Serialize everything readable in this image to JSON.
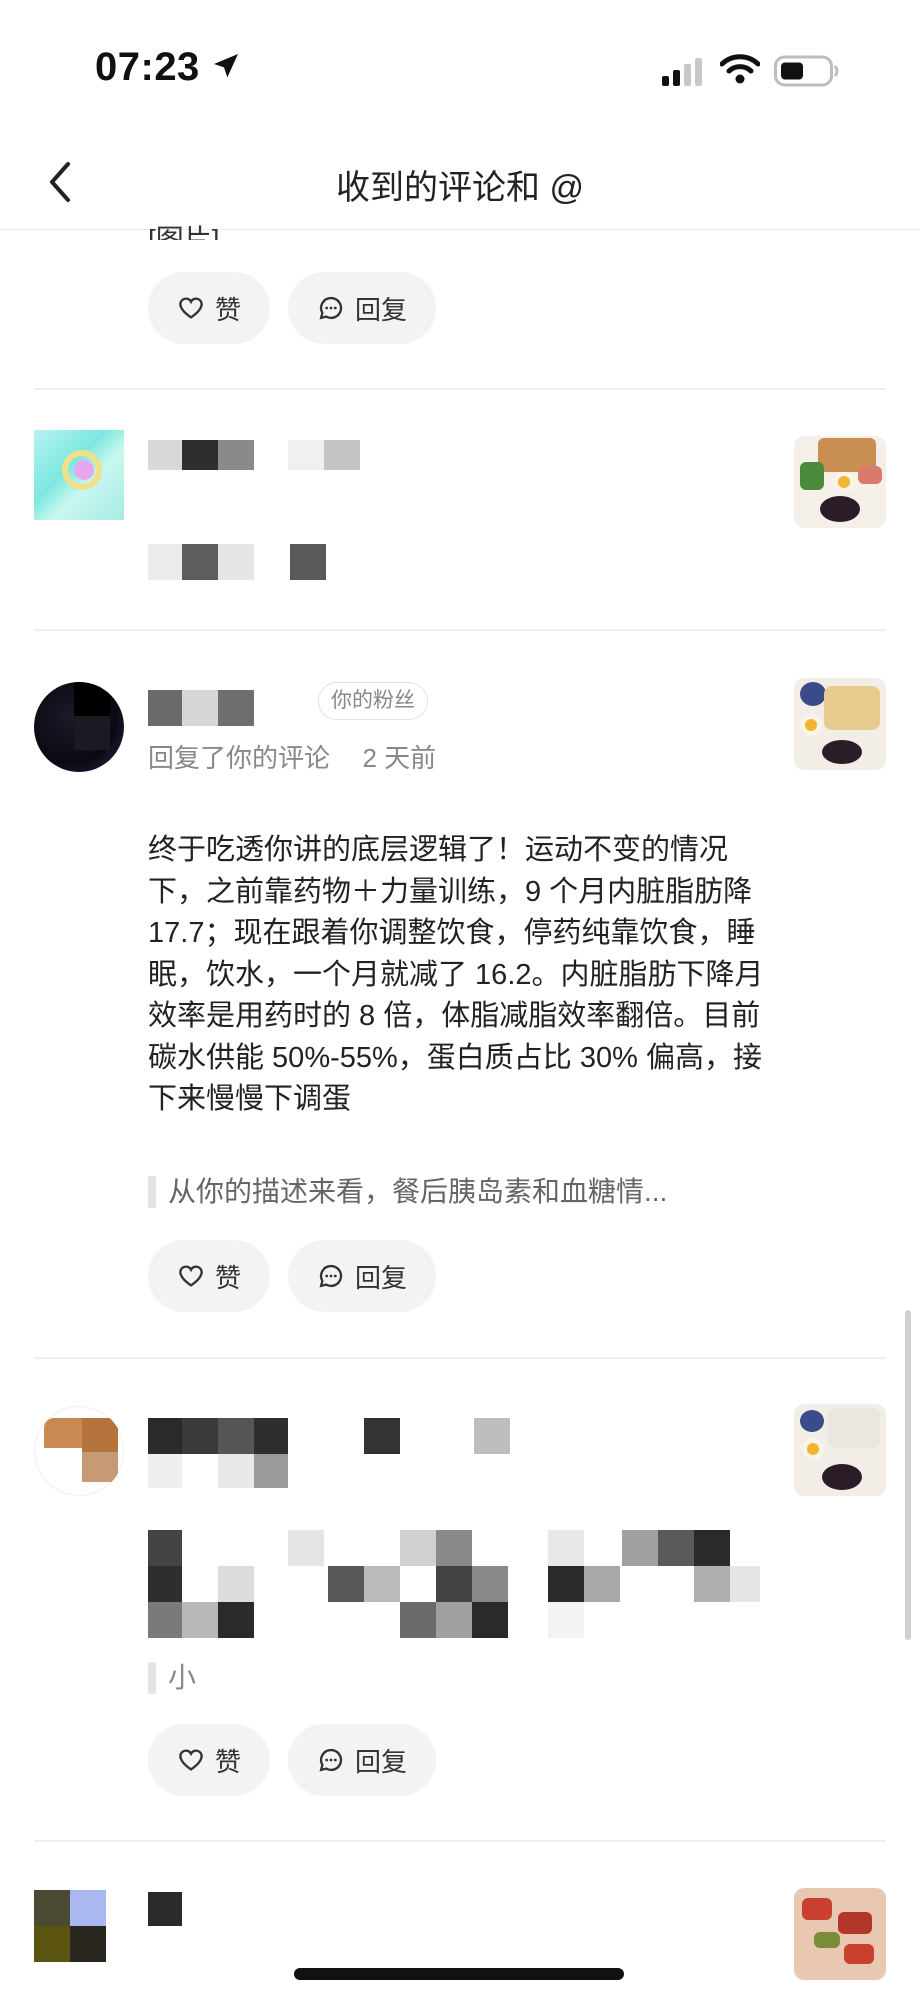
{
  "status": {
    "time": "07:23"
  },
  "nav": {
    "title": "收到的评论和 @"
  },
  "top_item": {
    "cut_text": "[图片]"
  },
  "actions": {
    "like": "赞",
    "reply": "回复"
  },
  "item2": {
    "badge": "你的粉丝",
    "meta": "回复了你的评论",
    "time": "2 天前",
    "body": "终于吃透你讲的底层逻辑了！运动不变的情况下，之前靠药物＋力量训练，9 个月内脏脂肪降 17.7；现在跟着你调整饮食，停药纯靠饮食，睡眠，饮水，一个月就减了 16.2。内脏脂肪下降月效率是用药时的 8 倍，体脂减脂效率翻倍。目前碳水供能 50%-55%，蛋白质占比 30% 偏高，接下来慢慢下调蛋",
    "quote": "从你的描述来看，餐后胰岛素和血糖情..."
  },
  "item3": {
    "quote": "小"
  },
  "colors": {
    "pill_bg": "#f3f3f3",
    "divider": "#efefef",
    "text": "#222222",
    "muted": "#888888"
  }
}
